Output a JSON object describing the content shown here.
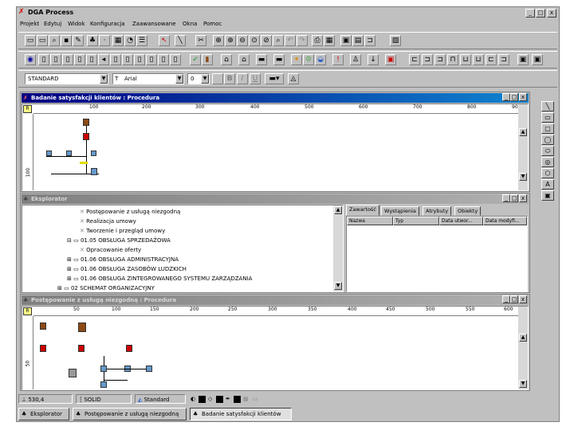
{
  "app": {
    "title": "DGA Process",
    "window_controls": {
      "minimize": "_",
      "maximize": "□",
      "close": "x"
    }
  },
  "menu": [
    "Projekt",
    "Edytuj",
    "Widok",
    "Konfiguracja",
    "Zaawansowane",
    "Okna",
    "Pomoc"
  ],
  "format_toolbar": {
    "style_value": "STANDARD",
    "font_value": "Arial",
    "size_value": "0",
    "bold": "B",
    "italic": "I",
    "underline": "U"
  },
  "win1": {
    "title": "Badanie satysfakcji klientów : Procedura",
    "ruler_ticks": [
      "100",
      "200",
      "300",
      "400",
      "500",
      "600",
      "700",
      "800",
      "900"
    ],
    "ruler_v_label": "100"
  },
  "explorer": {
    "title": "Eksplorator",
    "tree": [
      "Postępowanie z usługą niezgodną",
      "Realizacja umowy",
      "Tworzenie i przegląd umowy",
      "01.05 OBSŁUGA SPRZEDAŻOWA",
      "Opracowanie oferty",
      "01.06 OBSŁUGA ADMINISTRACYJNA",
      "01.06 OBSŁUGA ZASOBÓW LUDZKICH",
      "01.06 OBSŁUGA ZINTEGROWANEGO SYSTEMU ZARZĄDZANIA",
      "02 SCHEMAT ORGANIZACYJNY"
    ],
    "tabs": [
      "Zawartość",
      "Wystąpienia",
      "Atrybuty",
      "Obiekty"
    ],
    "columns": [
      "Nazwa",
      "Typ",
      "Data utwor...",
      "Data modyfi..."
    ]
  },
  "win3": {
    "title": "Postępowanie z usługą niezgodną : Procedura",
    "ruler_ticks": [
      "50",
      "100",
      "150",
      "200",
      "250",
      "300",
      "350",
      "400",
      "450",
      "500",
      "550",
      "600"
    ],
    "ruler_v_label": "50"
  },
  "status": {
    "coords": "530,4",
    "line_style": "SOLID",
    "style": "Standard"
  },
  "taskbar": [
    "Eksplorator",
    "Postępowanie z usługą niezgodną",
    "Badanie satysfakcji klientów"
  ],
  "colors": {
    "active_title": "#000080",
    "chrome": "#c0c0c0",
    "node_red": "#cc0000",
    "node_brown": "#8b4a16",
    "node_blue": "#6699cc"
  }
}
